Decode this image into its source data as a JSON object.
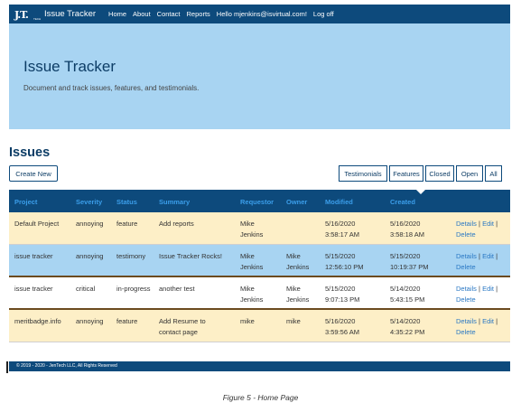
{
  "navbar": {
    "logo_text": "J.T.",
    "logo_sub": "TECH",
    "brand": "Issue Tracker",
    "links": [
      "Home",
      "About",
      "Contact",
      "Reports",
      "Hello mjenkins@isvirtual.com!",
      "Log off"
    ]
  },
  "jumbotron": {
    "title": "Issue Tracker",
    "subtitle": "Document and track issues, features, and testimonials."
  },
  "issues": {
    "title": "Issues",
    "create_label": "Create New",
    "filters": [
      "Testimonials",
      "Features",
      "Closed",
      "Open",
      "All"
    ]
  },
  "table": {
    "headers": [
      "Project",
      "Severity",
      "Status",
      "Summary",
      "Requestor",
      "Owner",
      "Modified",
      "Created"
    ],
    "rows": [
      {
        "project": "Default Project",
        "severity": "annoying",
        "status": "feature",
        "summary": "Add reports",
        "requestor": "Mike Jenkins",
        "owner": "",
        "modified_date": "5/16/2020",
        "modified_time": "3:58:17 AM",
        "created_date": "5/16/2020",
        "created_time": "3:58:18 AM",
        "details": "Details",
        "edit": "Edit",
        "delete": "Delete"
      },
      {
        "project": "issue tracker",
        "severity": "annoying",
        "status": "testimony",
        "summary": "Issue Tracker Rocks!",
        "requestor": "Mike Jenkins",
        "owner": "Mike Jenkins",
        "modified_date": "5/15/2020",
        "modified_time": "12:56:10 PM",
        "created_date": "5/15/2020",
        "created_time": "10:19:37 PM",
        "details": "Details",
        "edit": "Edit",
        "delete": "Delete"
      },
      {
        "project": "issue tracker",
        "severity": "critical",
        "status": "in-progress",
        "summary": "another test",
        "requestor": "Mike Jenkins",
        "owner": "Mike Jenkins",
        "modified_date": "5/15/2020",
        "modified_time": "9:07:13 PM",
        "created_date": "5/14/2020",
        "created_time": "5:43:15 PM",
        "details": "Details",
        "edit": "Edit",
        "delete": "Delete"
      },
      {
        "project": "meritbadge.info",
        "severity": "annoying",
        "status": "feature",
        "summary": "Add Resume to contact page",
        "requestor": "mike",
        "owner": "mike",
        "modified_date": "5/16/2020",
        "modified_time": "3:59:56 AM",
        "created_date": "5/14/2020",
        "created_time": "4:35:22 PM",
        "details": "Details",
        "edit": "Edit",
        "delete": "Delete"
      }
    ]
  },
  "footer": {
    "text": "© 2019 - 2020 - JenTech LLC, All Rights Reserved"
  },
  "caption": "Figure 5 - Home Page",
  "colors": {
    "navbar": "#0d4a7c",
    "jumbotron": "#a8d4f2",
    "row_yellow": "#fdefc7",
    "row_blue": "#a8d4f2",
    "header_text": "#3b9eea",
    "link": "#2a78c4"
  }
}
